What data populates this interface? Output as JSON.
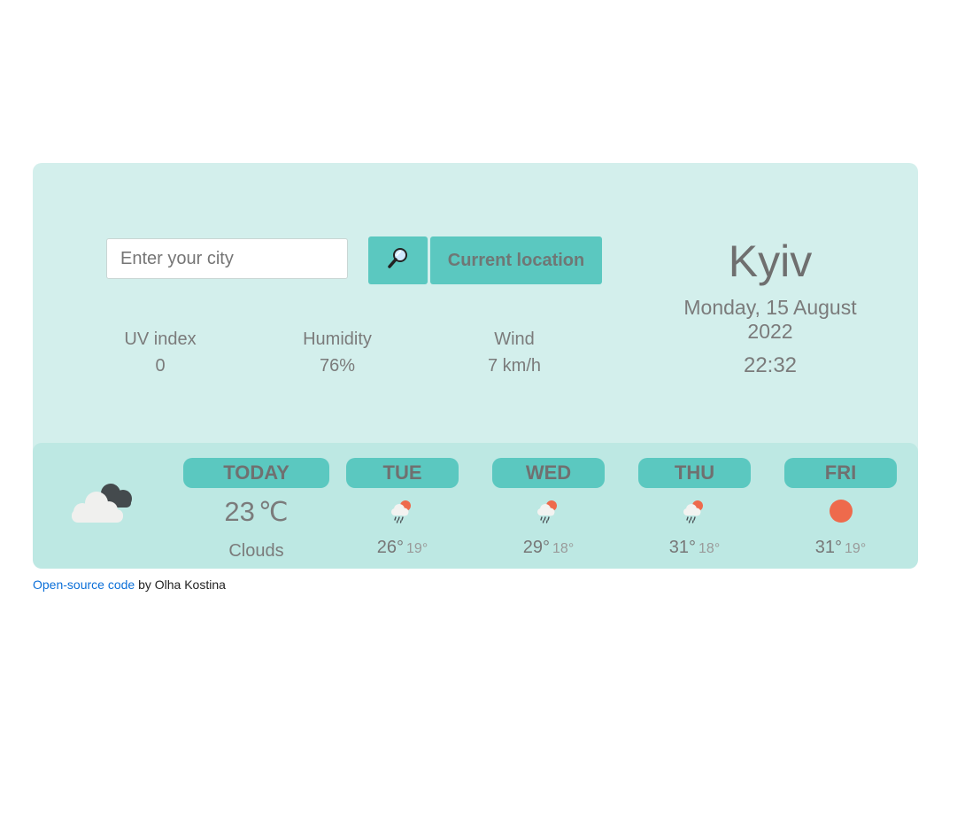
{
  "search": {
    "placeholder": "Enter your city",
    "value": "",
    "search_icon": "magnifying-glass-icon",
    "location_button_label": "Current location"
  },
  "stats": [
    {
      "label": "UV index",
      "value": "0"
    },
    {
      "label": "Humidity",
      "value": "76%"
    },
    {
      "label": "Wind",
      "value": "7 km/h"
    }
  ],
  "location": {
    "city": "Kyiv",
    "date": "Monday, 15 August 2022",
    "time": "22:32"
  },
  "today": {
    "label": "TODAY",
    "temp": "23",
    "unit": "℃",
    "description": "Clouds",
    "icon": "dark-clouds-icon"
  },
  "forecast": [
    {
      "day": "TUE",
      "max": "26°",
      "min": "19°",
      "icon": "rain-sun-icon"
    },
    {
      "day": "WED",
      "max": "29°",
      "min": "18°",
      "icon": "rain-sun-icon"
    },
    {
      "day": "THU",
      "max": "31°",
      "min": "18°",
      "icon": "rain-sun-icon"
    },
    {
      "day": "FRI",
      "max": "31°",
      "min": "19°",
      "icon": "sun-icon"
    }
  ],
  "footer": {
    "link_text": "Open-source code",
    "suffix": " by Olha Kostina"
  },
  "colors": {
    "card_bg": "#d3efec",
    "forecast_bg": "#bde8e3",
    "accent": "#5bc8c0",
    "sun": "#ee6a4c"
  }
}
